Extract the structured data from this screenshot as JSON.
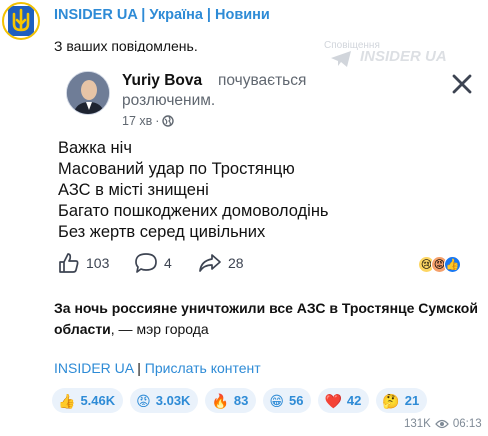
{
  "channel": {
    "title": "INSIDER UA | Україна | Новини",
    "avatar_icon": "ukraine-trident-icon"
  },
  "message": {
    "intro": "З ваших повідомлень.",
    "screenshot": {
      "author": "Yuriy Bova",
      "feeling_1": "почувається",
      "feeling_2": "розлюченим.",
      "time": "17 хв",
      "watermark_small": "Сповіщення",
      "watermark_big": "INSIDER UA",
      "lines": [
        "Важка ніч",
        "Масований удар по Тростянцю",
        "АЗС в місті знищені",
        "Багато пошкоджених домоволодінь",
        "Без жертв серед цивільних"
      ],
      "likes": "103",
      "comments": "4",
      "shares": "28"
    },
    "caption_bold": "За ночь россияне уничтожили все АЗС в Тростянце Сумской области",
    "caption_rest": ", — мэр города",
    "link_channel": "INSIDER UA",
    "link_separator": " | ",
    "link_submit": "Прислать контент"
  },
  "reactions": [
    {
      "emoji": "👍",
      "count": "5.46K"
    },
    {
      "emoji": "😡",
      "count": "3.03K"
    },
    {
      "emoji": "🔥",
      "count": "83"
    },
    {
      "emoji": "😁",
      "count": "56"
    },
    {
      "emoji": "❤️",
      "count": "42"
    },
    {
      "emoji": "🤔",
      "count": "21"
    }
  ],
  "meta": {
    "views": "131K",
    "time": "06:13"
  },
  "colors": {
    "accent": "#2e8bd6",
    "pill_bg": "#eaf2fb"
  }
}
